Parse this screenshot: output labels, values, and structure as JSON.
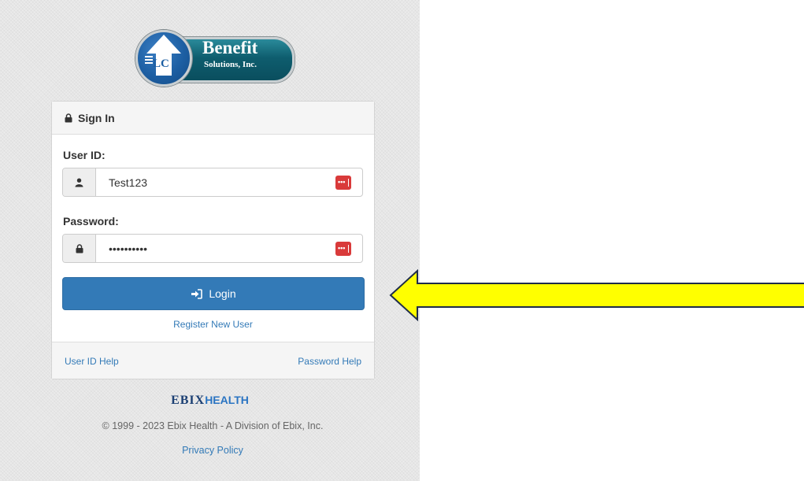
{
  "logo": {
    "line1": "Benefit",
    "line2": "Solutions, Inc.",
    "monogram": "LC",
    "color": "#0e5d6e"
  },
  "signin": {
    "title": "Sign In",
    "user_label": "User ID:",
    "user_value": "Test123",
    "password_label": "Password:",
    "password_value": "Password12",
    "login_label": "Login",
    "register_label": "Register New User",
    "user_id_help": "User ID Help",
    "password_help": "Password Help"
  },
  "footer": {
    "brand_a": "EBIX",
    "brand_b": "HEALTH",
    "copyright": "© 1999 - 2023 Ebix Health - A Division of Ebix, Inc.",
    "privacy": "Privacy Policy"
  },
  "colors": {
    "primary": "#337ab7",
    "callout": "#ffff00",
    "ext_icon": "#d93a3a"
  },
  "icons": [
    "lock-icon",
    "user-icon",
    "password-manager-icon",
    "login-icon",
    "arrow-callout-icon"
  ]
}
